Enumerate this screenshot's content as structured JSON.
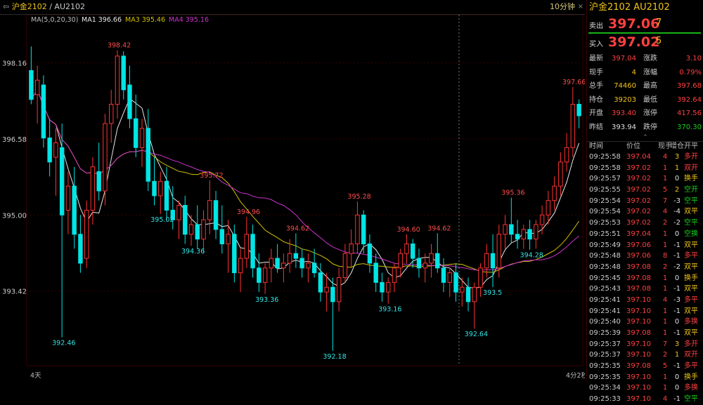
{
  "title_bar": {
    "symbol": "沪金2102",
    "separator": " / ",
    "code": "AU2102",
    "period": "10分钟",
    "close_symbol": "×"
  },
  "legend": {
    "ma": "MA(5,0,20,30)",
    "ma1": "MA1 396.66",
    "ma3": "MA3 395.46",
    "ma4": "MA4 395.16"
  },
  "colors": {
    "up": "#ff3333",
    "down": "#00e5e5",
    "ma1": "#e8e8e8",
    "ma3": "#d4c000",
    "ma4": "#cc33cc",
    "grid": "#3a0000"
  },
  "axis_footer": {
    "left": "4天",
    "right": "4分2秒"
  },
  "chart_data": {
    "type": "candlestick",
    "ylim": [
      391.9,
      399.1
    ],
    "y_ticks": [
      "398.16",
      "396.58",
      "395.00",
      "393.42"
    ],
    "y_tick_values": [
      398.16,
      396.58,
      395.0,
      393.42
    ],
    "annotations": [
      {
        "i": 5,
        "v": 392.46,
        "text": "392.46"
      },
      {
        "i": 14,
        "v": 398.42,
        "text": "398.42"
      },
      {
        "i": 21,
        "v": 395.02,
        "text": "395.02"
      },
      {
        "i": 29,
        "v": 395.72,
        "text": "395.72"
      },
      {
        "i": 26,
        "v": 394.36,
        "text": "394.36"
      },
      {
        "i": 35,
        "v": 394.96,
        "text": "394.96"
      },
      {
        "i": 38,
        "v": 393.36,
        "text": "393.36"
      },
      {
        "i": 43,
        "v": 394.62,
        "text": "394.62"
      },
      {
        "i": 49,
        "v": 392.18,
        "text": "392.18"
      },
      {
        "i": 53,
        "v": 395.28,
        "text": "395.28"
      },
      {
        "i": 58,
        "v": 393.16,
        "text": "393.16"
      },
      {
        "i": 61,
        "v": 394.6,
        "text": "394.60"
      },
      {
        "i": 66,
        "v": 394.62,
        "text": "394.62"
      },
      {
        "i": 72,
        "v": 392.64,
        "text": "392.64"
      },
      {
        "i": 75,
        "v": 393.5,
        "text": "393.5"
      },
      {
        "i": 78,
        "v": 395.36,
        "text": "395.36"
      },
      {
        "i": 81,
        "v": 394.28,
        "text": "394.28"
      },
      {
        "i": 88,
        "v": 397.66,
        "text": "397.66"
      }
    ],
    "candles": [
      {
        "o": 398.0,
        "h": 398.5,
        "l": 397.3,
        "c": 397.4
      },
      {
        "o": 397.5,
        "h": 398.1,
        "l": 396.9,
        "c": 397.8
      },
      {
        "o": 397.7,
        "h": 397.9,
        "l": 396.4,
        "c": 396.6
      },
      {
        "o": 396.6,
        "h": 397.0,
        "l": 395.8,
        "c": 396.1
      },
      {
        "o": 396.2,
        "h": 396.8,
        "l": 395.4,
        "c": 396.5
      },
      {
        "o": 396.4,
        "h": 396.9,
        "l": 392.46,
        "c": 395.0
      },
      {
        "o": 395.1,
        "h": 395.9,
        "l": 394.6,
        "c": 395.6
      },
      {
        "o": 395.6,
        "h": 396.0,
        "l": 394.3,
        "c": 394.6
      },
      {
        "o": 394.6,
        "h": 395.0,
        "l": 393.8,
        "c": 394.0
      },
      {
        "o": 394.1,
        "h": 395.3,
        "l": 393.9,
        "c": 395.1
      },
      {
        "o": 395.1,
        "h": 396.2,
        "l": 394.8,
        "c": 396.0
      },
      {
        "o": 395.9,
        "h": 396.5,
        "l": 395.3,
        "c": 395.5
      },
      {
        "o": 395.5,
        "h": 397.1,
        "l": 395.2,
        "c": 396.9
      },
      {
        "o": 396.9,
        "h": 397.6,
        "l": 396.5,
        "c": 397.3
      },
      {
        "o": 397.3,
        "h": 398.42,
        "l": 397.0,
        "c": 398.3
      },
      {
        "o": 398.3,
        "h": 398.4,
        "l": 397.4,
        "c": 397.6
      },
      {
        "o": 397.7,
        "h": 398.1,
        "l": 396.8,
        "c": 397.0
      },
      {
        "o": 397.0,
        "h": 397.5,
        "l": 396.2,
        "c": 396.4
      },
      {
        "o": 396.4,
        "h": 397.0,
        "l": 396.0,
        "c": 396.8
      },
      {
        "o": 396.8,
        "h": 397.2,
        "l": 395.5,
        "c": 395.7
      },
      {
        "o": 395.7,
        "h": 396.2,
        "l": 395.2,
        "c": 395.4
      },
      {
        "o": 395.4,
        "h": 395.9,
        "l": 395.02,
        "c": 395.7
      },
      {
        "o": 395.7,
        "h": 396.0,
        "l": 394.9,
        "c": 395.1
      },
      {
        "o": 395.1,
        "h": 395.6,
        "l": 394.7,
        "c": 394.9
      },
      {
        "o": 394.9,
        "h": 395.3,
        "l": 394.5,
        "c": 395.2
      },
      {
        "o": 395.2,
        "h": 395.4,
        "l": 394.4,
        "c": 394.6
      },
      {
        "o": 394.6,
        "h": 395.0,
        "l": 394.36,
        "c": 394.8
      },
      {
        "o": 394.8,
        "h": 395.2,
        "l": 394.3,
        "c": 394.5
      },
      {
        "o": 394.5,
        "h": 395.1,
        "l": 394.2,
        "c": 394.9
      },
      {
        "o": 394.9,
        "h": 395.72,
        "l": 394.6,
        "c": 395.3
      },
      {
        "o": 395.3,
        "h": 395.5,
        "l": 394.5,
        "c": 394.7
      },
      {
        "o": 394.7,
        "h": 395.2,
        "l": 394.2,
        "c": 394.4
      },
      {
        "o": 394.4,
        "h": 394.9,
        "l": 393.8,
        "c": 394.6
      },
      {
        "o": 394.6,
        "h": 394.8,
        "l": 393.6,
        "c": 393.8
      },
      {
        "o": 393.8,
        "h": 394.3,
        "l": 393.4,
        "c": 394.1
      },
      {
        "o": 394.1,
        "h": 394.96,
        "l": 393.9,
        "c": 394.6
      },
      {
        "o": 394.6,
        "h": 394.8,
        "l": 393.7,
        "c": 393.9
      },
      {
        "o": 393.9,
        "h": 394.2,
        "l": 393.4,
        "c": 393.6
      },
      {
        "o": 393.6,
        "h": 394.0,
        "l": 393.36,
        "c": 393.9
      },
      {
        "o": 393.9,
        "h": 394.3,
        "l": 393.6,
        "c": 394.1
      },
      {
        "o": 394.1,
        "h": 394.4,
        "l": 393.8,
        "c": 393.9
      },
      {
        "o": 393.9,
        "h": 394.2,
        "l": 393.6,
        "c": 394.0
      },
      {
        "o": 394.0,
        "h": 394.5,
        "l": 393.8,
        "c": 394.2
      },
      {
        "o": 394.2,
        "h": 394.62,
        "l": 393.9,
        "c": 394.1
      },
      {
        "o": 394.1,
        "h": 394.3,
        "l": 393.7,
        "c": 393.9
      },
      {
        "o": 393.9,
        "h": 394.2,
        "l": 393.6,
        "c": 394.0
      },
      {
        "o": 394.0,
        "h": 394.3,
        "l": 393.7,
        "c": 393.8
      },
      {
        "o": 393.8,
        "h": 394.0,
        "l": 393.2,
        "c": 393.4
      },
      {
        "o": 393.4,
        "h": 393.8,
        "l": 393.0,
        "c": 393.5
      },
      {
        "o": 393.5,
        "h": 393.7,
        "l": 392.18,
        "c": 393.2
      },
      {
        "o": 393.2,
        "h": 393.9,
        "l": 393.0,
        "c": 393.7
      },
      {
        "o": 393.7,
        "h": 394.4,
        "l": 393.6,
        "c": 394.2
      },
      {
        "o": 394.2,
        "h": 394.7,
        "l": 393.9,
        "c": 394.4
      },
      {
        "o": 394.4,
        "h": 395.28,
        "l": 394.2,
        "c": 395.0
      },
      {
        "o": 395.0,
        "h": 395.1,
        "l": 394.2,
        "c": 394.4
      },
      {
        "o": 394.4,
        "h": 394.6,
        "l": 393.8,
        "c": 394.0
      },
      {
        "o": 394.0,
        "h": 394.2,
        "l": 393.4,
        "c": 393.6
      },
      {
        "o": 393.6,
        "h": 393.8,
        "l": 393.2,
        "c": 393.4
      },
      {
        "o": 393.4,
        "h": 393.7,
        "l": 393.16,
        "c": 393.6
      },
      {
        "o": 393.6,
        "h": 394.0,
        "l": 393.4,
        "c": 393.9
      },
      {
        "o": 393.9,
        "h": 394.3,
        "l": 393.7,
        "c": 394.2
      },
      {
        "o": 394.2,
        "h": 394.6,
        "l": 394.0,
        "c": 394.4
      },
      {
        "o": 394.4,
        "h": 394.5,
        "l": 393.9,
        "c": 394.1
      },
      {
        "o": 394.1,
        "h": 394.3,
        "l": 393.7,
        "c": 393.9
      },
      {
        "o": 393.9,
        "h": 394.2,
        "l": 393.6,
        "c": 394.0
      },
      {
        "o": 394.0,
        "h": 394.4,
        "l": 393.7,
        "c": 394.2
      },
      {
        "o": 394.2,
        "h": 394.62,
        "l": 393.8,
        "c": 393.9
      },
      {
        "o": 393.9,
        "h": 394.1,
        "l": 393.4,
        "c": 393.6
      },
      {
        "o": 393.6,
        "h": 393.9,
        "l": 393.3,
        "c": 393.8
      },
      {
        "o": 393.8,
        "h": 394.0,
        "l": 393.2,
        "c": 393.4
      },
      {
        "o": 393.4,
        "h": 393.7,
        "l": 393.1,
        "c": 393.5
      },
      {
        "o": 393.5,
        "h": 393.7,
        "l": 393.0,
        "c": 393.2
      },
      {
        "o": 393.2,
        "h": 393.6,
        "l": 392.64,
        "c": 393.5
      },
      {
        "o": 393.5,
        "h": 394.0,
        "l": 393.3,
        "c": 393.9
      },
      {
        "o": 393.9,
        "h": 394.4,
        "l": 393.7,
        "c": 394.2
      },
      {
        "o": 394.2,
        "h": 394.6,
        "l": 393.5,
        "c": 393.9
      },
      {
        "o": 393.9,
        "h": 394.8,
        "l": 393.7,
        "c": 394.6
      },
      {
        "o": 394.6,
        "h": 395.0,
        "l": 394.3,
        "c": 394.8
      },
      {
        "o": 394.8,
        "h": 395.36,
        "l": 394.4,
        "c": 394.6
      },
      {
        "o": 394.6,
        "h": 394.9,
        "l": 394.3,
        "c": 394.5
      },
      {
        "o": 394.5,
        "h": 394.8,
        "l": 394.3,
        "c": 394.7
      },
      {
        "o": 394.7,
        "h": 394.9,
        "l": 394.28,
        "c": 394.5
      },
      {
        "o": 394.5,
        "h": 394.9,
        "l": 394.3,
        "c": 394.8
      },
      {
        "o": 394.8,
        "h": 395.2,
        "l": 394.6,
        "c": 395.0
      },
      {
        "o": 395.0,
        "h": 395.5,
        "l": 394.8,
        "c": 395.3
      },
      {
        "o": 395.3,
        "h": 395.8,
        "l": 395.1,
        "c": 395.6
      },
      {
        "o": 395.6,
        "h": 396.3,
        "l": 395.4,
        "c": 396.1
      },
      {
        "o": 396.1,
        "h": 396.7,
        "l": 395.9,
        "c": 396.4
      },
      {
        "o": 396.4,
        "h": 397.66,
        "l": 396.2,
        "c": 397.3
      },
      {
        "o": 397.3,
        "h": 397.4,
        "l": 396.8,
        "c": 397.06
      }
    ]
  },
  "sidebar": {
    "header": "沪金2102    AU2102",
    "ask": {
      "label": "卖出",
      "price": "397.06",
      "vol": "7"
    },
    "bid": {
      "label": "买入",
      "price": "397.02",
      "vol": "5"
    },
    "stats": [
      {
        "k1": "最新",
        "v1": "397.04",
        "c1": "red",
        "k2": "涨跌",
        "v2": "3.10",
        "c2": "red"
      },
      {
        "k1": "现手",
        "v1": "4",
        "c1": "yellow",
        "k2": "涨幅",
        "v2": "0.79%",
        "c2": "red"
      },
      {
        "k1": "总手",
        "v1": "74460",
        "c1": "yellow",
        "k2": "最高",
        "v2": "397.68",
        "c2": "red"
      },
      {
        "k1": "持仓",
        "v1": "39203",
        "c1": "yellow",
        "k2": "最低",
        "v2": "392.64",
        "c2": "red"
      },
      {
        "k1": "开盘",
        "v1": "393.40",
        "c1": "red",
        "k2": "涨停",
        "v2": "417.56",
        "c2": "red"
      },
      {
        "k1": "昨结",
        "v1": "393.94",
        "c1": "white",
        "k2": "跌停",
        "v2": "370.30",
        "c2": "green"
      }
    ],
    "chevron": "⌃",
    "tick_header": {
      "t": "时间",
      "p": "价位",
      "v": "现手",
      "o": "增仓",
      "k": "开平"
    },
    "ticks": [
      {
        "t": "09:25:58",
        "p": "397.04",
        "v": "4",
        "o": "3",
        "k": "多开",
        "kc": "red",
        "oc": "yellow"
      },
      {
        "t": "09:25:58",
        "p": "397.02",
        "v": "1",
        "o": "1",
        "k": "双开",
        "kc": "red",
        "oc": "yellow"
      },
      {
        "t": "09:25:57",
        "p": "397.02",
        "v": "1",
        "o": "0",
        "k": "换手",
        "kc": "yellow",
        "oc": "white"
      },
      {
        "t": "09:25:55",
        "p": "397.02",
        "v": "5",
        "o": "2",
        "k": "空开",
        "kc": "green",
        "oc": "yellow"
      },
      {
        "t": "09:25:54",
        "p": "397.02",
        "v": "7",
        "o": "-3",
        "k": "空平",
        "kc": "green",
        "oc": "white"
      },
      {
        "t": "09:25:54",
        "p": "397.02",
        "v": "4",
        "o": "-4",
        "k": "双平",
        "kc": "yellow",
        "oc": "white"
      },
      {
        "t": "09:25:53",
        "p": "397.02",
        "v": "2",
        "o": "-2",
        "k": "空平",
        "kc": "green",
        "oc": "white"
      },
      {
        "t": "09:25:51",
        "p": "397.04",
        "v": "1",
        "o": "0",
        "k": "空换",
        "kc": "green",
        "oc": "white"
      },
      {
        "t": "09:25:49",
        "p": "397.06",
        "v": "1",
        "o": "-1",
        "k": "双平",
        "kc": "yellow",
        "oc": "white"
      },
      {
        "t": "09:25:48",
        "p": "397.06",
        "v": "8",
        "o": "-1",
        "k": "多平",
        "kc": "red",
        "oc": "white"
      },
      {
        "t": "09:25:48",
        "p": "397.08",
        "v": "2",
        "o": "-2",
        "k": "双平",
        "kc": "yellow",
        "oc": "white"
      },
      {
        "t": "09:25:45",
        "p": "397.08",
        "v": "1",
        "o": "0",
        "k": "换手",
        "kc": "yellow",
        "oc": "white"
      },
      {
        "t": "09:25:43",
        "p": "397.08",
        "v": "1",
        "o": "-1",
        "k": "双平",
        "kc": "yellow",
        "oc": "white"
      },
      {
        "t": "09:25:41",
        "p": "397.10",
        "v": "4",
        "o": "-3",
        "k": "多平",
        "kc": "red",
        "oc": "white"
      },
      {
        "t": "09:25:41",
        "p": "397.10",
        "v": "1",
        "o": "-1",
        "k": "双平",
        "kc": "yellow",
        "oc": "white"
      },
      {
        "t": "09:25:40",
        "p": "397.10",
        "v": "1",
        "o": "0",
        "k": "多换",
        "kc": "red",
        "oc": "white"
      },
      {
        "t": "09:25:39",
        "p": "397.08",
        "v": "1",
        "o": "-1",
        "k": "双平",
        "kc": "yellow",
        "oc": "white"
      },
      {
        "t": "09:25:37",
        "p": "397.10",
        "v": "7",
        "o": "3",
        "k": "多开",
        "kc": "red",
        "oc": "yellow"
      },
      {
        "t": "09:25:37",
        "p": "397.10",
        "v": "2",
        "o": "1",
        "k": "双开",
        "kc": "red",
        "oc": "yellow"
      },
      {
        "t": "09:25:35",
        "p": "397.08",
        "v": "5",
        "o": "-1",
        "k": "多平",
        "kc": "red",
        "oc": "white"
      },
      {
        "t": "09:25:35",
        "p": "397.10",
        "v": "1",
        "o": "0",
        "k": "换手",
        "kc": "yellow",
        "oc": "white"
      },
      {
        "t": "09:25:34",
        "p": "397.10",
        "v": "1",
        "o": "0",
        "k": "多换",
        "kc": "red",
        "oc": "white"
      },
      {
        "t": "09:25:33",
        "p": "397.10",
        "v": "4",
        "o": "-1",
        "k": "空平",
        "kc": "green",
        "oc": "white"
      }
    ]
  }
}
